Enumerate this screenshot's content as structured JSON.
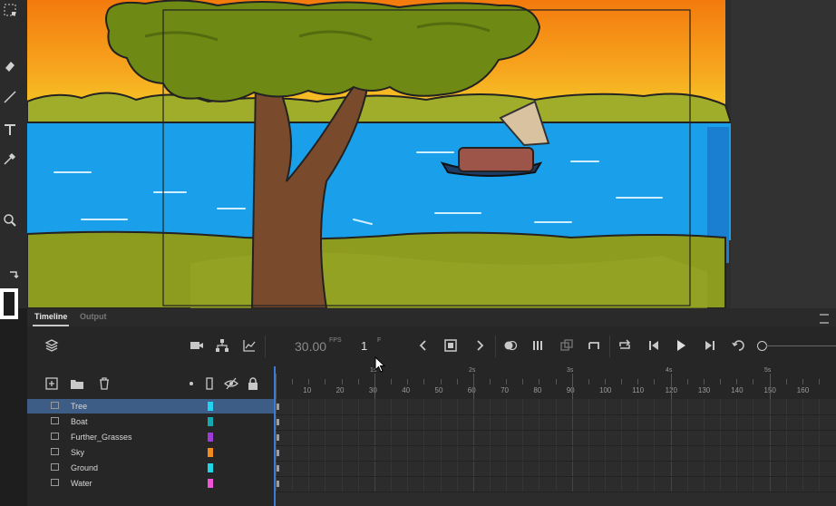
{
  "icons": {
    "toolbar": [
      "transform-icon",
      "eraser-icon",
      "line-icon",
      "text-icon",
      "eyedropper-icon",
      "zoom-icon",
      "swap-icon"
    ],
    "timeline_left": [
      "layer-stack-icon",
      "camera-icon",
      "hierarchy-icon",
      "graph-icon"
    ],
    "layer_actions": [
      "new-layer-icon",
      "new-folder-icon",
      "delete-icon",
      "highlight-dot-icon",
      "outline-icon",
      "visibility-icon",
      "lock-icon"
    ]
  },
  "panel": {
    "tabs": [
      {
        "label": "Timeline",
        "active": true
      },
      {
        "label": "Output",
        "active": false
      }
    ]
  },
  "controls": {
    "fps_value": "30.00",
    "fps_unit": "FPS",
    "frame_value": "1",
    "frame_unit": "F"
  },
  "ruler": {
    "seconds": [
      "1s",
      "2s",
      "3s",
      "4s",
      "5s"
    ],
    "frames": [
      "10",
      "20",
      "30",
      "40",
      "50",
      "60",
      "70",
      "80",
      "90",
      "100",
      "110",
      "120",
      "130",
      "140",
      "150",
      "160"
    ]
  },
  "layers": [
    {
      "name": "Tree",
      "color": "#22d3f0",
      "selected": true
    },
    {
      "name": "Boat",
      "color": "#16a8b0",
      "selected": false
    },
    {
      "name": "Further_Grasses",
      "color": "#a13bd6",
      "selected": false
    },
    {
      "name": "Sky",
      "color": "#f28a1c",
      "selected": false
    },
    {
      "name": "Ground",
      "color": "#1fd6e6",
      "selected": false
    },
    {
      "name": "Water",
      "color": "#f254d8",
      "selected": false
    }
  ],
  "colors": {
    "selection": "#3d5c86",
    "playhead": "#3a7ad9",
    "sky_top": "#f5a21b",
    "sky_bottom": "#f6d32a",
    "water": "#1aa0ea",
    "grass": "#8d9b1e"
  }
}
